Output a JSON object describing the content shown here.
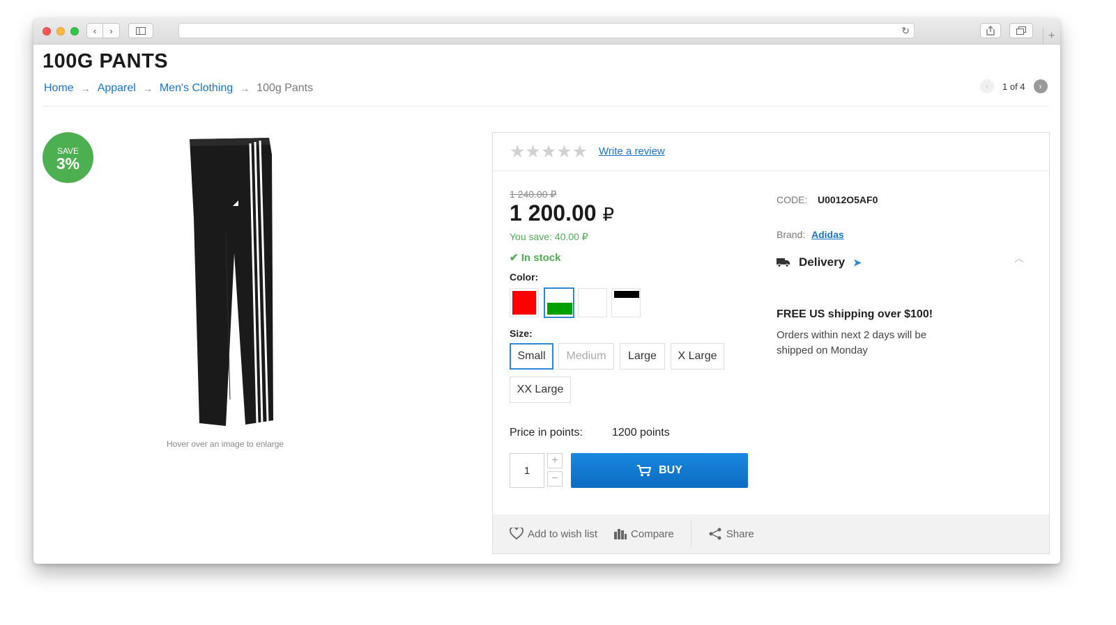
{
  "page": {
    "title": "100G PANTS",
    "breadcrumb": [
      "Home",
      "Apparel",
      "Men's Clothing",
      "100g Pants"
    ],
    "breadcrumb_sep": "→",
    "pager": "1 of 4",
    "save_badge": {
      "label": "SAVE",
      "value": "3%"
    },
    "hover_hint": "Hover over an image to enlarge"
  },
  "product": {
    "write_review": "Write a review",
    "rating": 0,
    "old_price": "1 240.00 ₽",
    "price": "1 200.00",
    "currency": "₽",
    "you_save": "You save: 40.00 ₽",
    "stock": "In stock",
    "color_label": "Color:",
    "colors": [
      "#ff0000",
      "#00a000",
      "#ffffff",
      "#000000"
    ],
    "size_label": "Size:",
    "sizes": [
      "Small",
      "Medium",
      "Large",
      "X Large",
      "XX Large"
    ],
    "selected_size": "Small",
    "points_label": "Price in points:",
    "points_value": "1200 points",
    "quantity": "1",
    "buy_label": "BUY",
    "code_label": "CODE:",
    "code_value": "U0012O5AF0",
    "brand_label": "Brand:",
    "brand_value": "Adidas",
    "delivery_label": "Delivery",
    "shipping_title": "FREE US shipping over $100!",
    "shipping_text": "Orders within next 2 days will be shipped on Monday",
    "wishlist_label": "Add to wish list",
    "compare_label": "Compare",
    "share_label": "Share",
    "accent_color": "#1a88e0",
    "success_color": "#4caf50"
  }
}
